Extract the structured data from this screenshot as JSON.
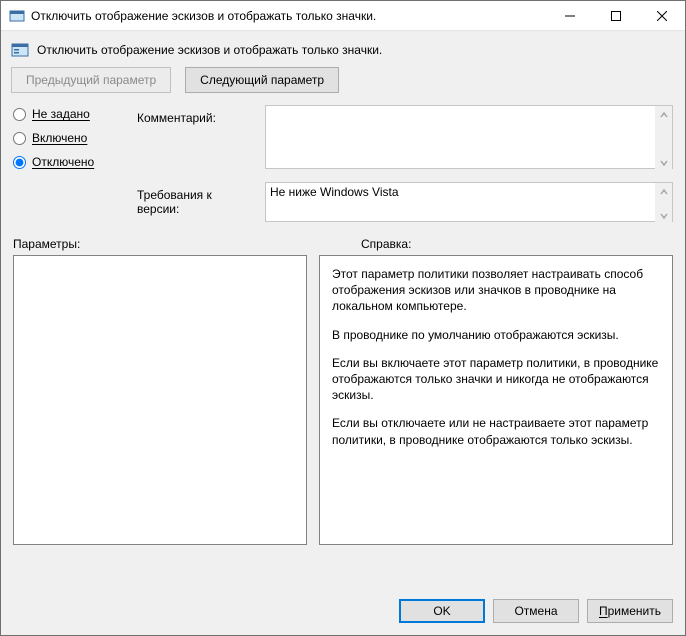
{
  "window": {
    "title": "Отключить отображение эскизов и отображать только значки."
  },
  "header": {
    "title": "Отключить отображение эскизов и отображать только значки."
  },
  "nav": {
    "prev": "Предыдущий параметр",
    "next": "Следующий параметр"
  },
  "state": {
    "options": {
      "not_configured": "Не задано",
      "enabled": "Включено",
      "disabled": "Отключено"
    },
    "selected": "disabled"
  },
  "labels": {
    "comment": "Комментарий:",
    "supported": "Требования к версии:",
    "options_pane": "Параметры:",
    "help_pane": "Справка:"
  },
  "fields": {
    "comment": "",
    "supported": "Не ниже Windows Vista"
  },
  "help": {
    "p1": "Этот параметр политики позволяет настраивать способ отображения эскизов или значков в проводнике на локальном компьютере.",
    "p2": "В проводнике по умолчанию отображаются эскизы.",
    "p3": "Если вы включаете этот параметр политики, в проводнике отображаются только значки и никогда не отображаются эскизы.",
    "p4": "Если вы отключаете или не настраиваете этот параметр политики, в проводнике отображаются только эскизы."
  },
  "footer": {
    "ok": "OK",
    "cancel": "Отмена",
    "apply_prefix": "П",
    "apply_rest": "рименить"
  }
}
